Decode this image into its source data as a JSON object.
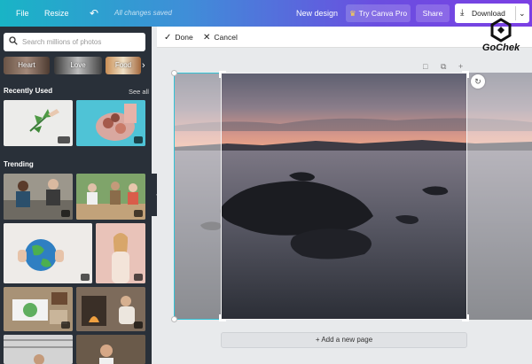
{
  "topbar": {
    "file": "File",
    "resize": "Resize",
    "undo_icon": "undo-icon",
    "saved_status": "All changes saved",
    "new_design": "New design",
    "try_pro": "Try Canva Pro",
    "share": "Share",
    "download": "Download"
  },
  "left_panel": {
    "search_placeholder": "Search millions of photos",
    "chips": [
      "Heart",
      "Love",
      "Food"
    ],
    "recently_used_title": "Recently Used",
    "see_all": "See all",
    "trending_title": "Trending"
  },
  "edit_toolbar": {
    "done": "Done",
    "cancel": "Cancel"
  },
  "canvas": {
    "add_page": "+ Add a new page"
  },
  "watermark": {
    "text": "GoChek"
  },
  "colors": {
    "accent_teal": "#33c3d6",
    "panel_bg": "#293039",
    "topbar_start": "#19b4c6",
    "topbar_end": "#7b3fe4"
  }
}
